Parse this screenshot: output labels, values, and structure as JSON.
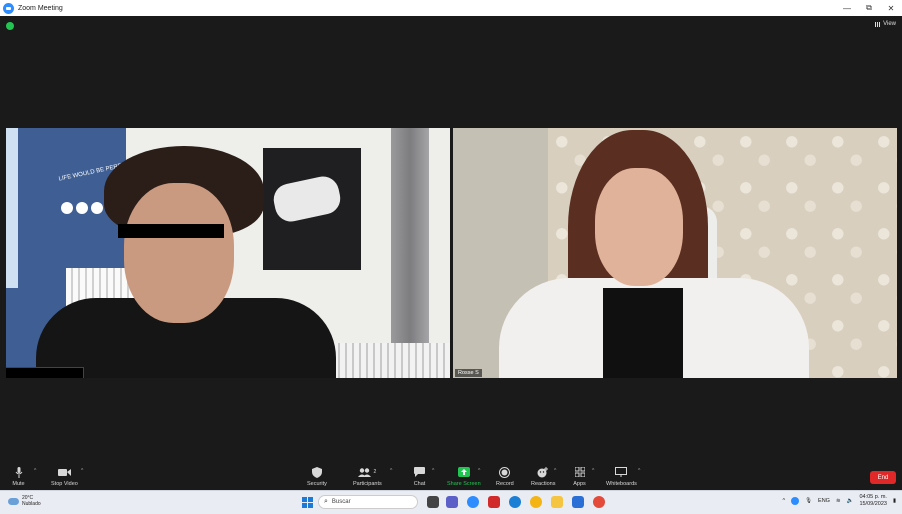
{
  "window": {
    "title": "Zoom Meeting",
    "controls": [
      "—",
      "⧉",
      "✕"
    ]
  },
  "meeting": {
    "view_label": "View",
    "participants": [
      {
        "name": ""
      },
      {
        "name": "Rosse S"
      }
    ],
    "left_wall_text": "LIFE WOULD BE PERFECT IF"
  },
  "toolbar": {
    "mute": "Mute",
    "stop_video": "Stop Video",
    "security": "Security",
    "participants": "Participants",
    "participants_count": "2",
    "chat": "Chat",
    "share_screen": "Share Screen",
    "record": "Record",
    "reactions": "Reactions",
    "apps": "Apps",
    "whiteboards": "Whiteboards",
    "end": "End"
  },
  "taskbar": {
    "weather_temp": "20°C",
    "weather_desc": "Nublado",
    "search_placeholder": "Buscar",
    "language": "ENG",
    "time": "04:05 p. m.",
    "date": "15/09/2023"
  },
  "colors": {
    "zoom_blue": "#2d8cff",
    "share_green": "#23c552",
    "end_red": "#e02828"
  }
}
